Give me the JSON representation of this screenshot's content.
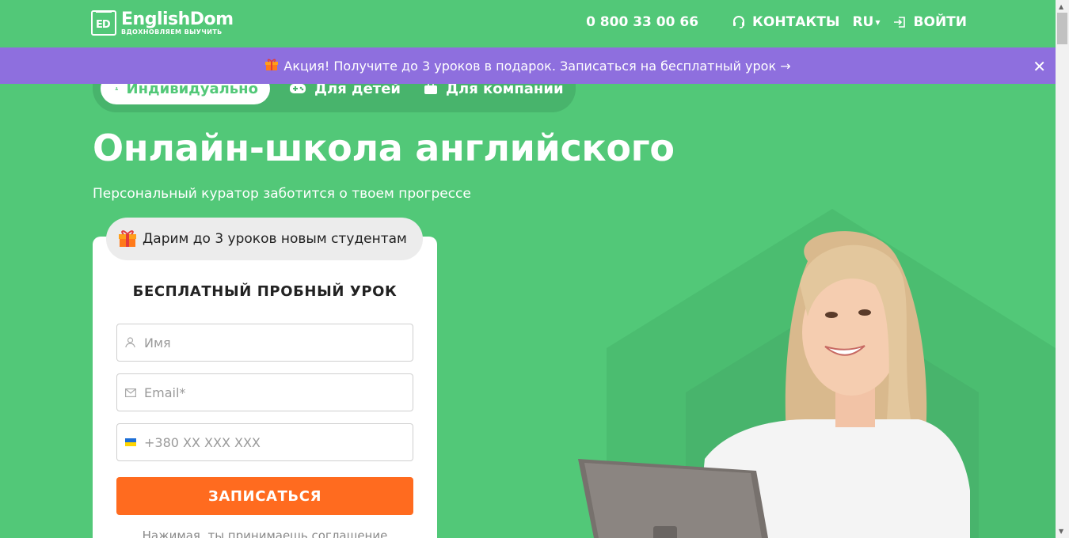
{
  "header": {
    "logo_mark": "ED",
    "logo_name": "EnglishDom",
    "logo_tagline": "ВДОХНОВЛЯЕМ ВЫУЧИТЬ",
    "phone": "0 800 33 00 66",
    "contacts_label": "КОНТАКТЫ",
    "lang": "RU",
    "login_label": "ВОЙТИ"
  },
  "promo": {
    "text": "Акция! Получите до 3 уроков в подарок. Записаться на бесплатный урок →",
    "close": "✕"
  },
  "tabs": [
    {
      "label": "Индивидуально",
      "active": true
    },
    {
      "label": "Для детей",
      "active": false
    },
    {
      "label": "Для компании",
      "active": false
    }
  ],
  "hero": {
    "title": "Онлайн-школа английского",
    "subtitle": "Персональный куратор заботится о твоем прогрессе"
  },
  "form": {
    "gift_text": "Дарим до 3 уроков новым студентам",
    "title": "БЕСПЛАТНЫЙ ПРОБНЫЙ УРОК",
    "name_placeholder": "Имя",
    "email_placeholder": "Email*",
    "phone_placeholder": "+380 XX XXX XXX",
    "submit_label": "ЗАПИСАТЬСЯ",
    "agreement": "Нажимая, ты принимаешь соглашение"
  },
  "colors": {
    "brand_green": "#52c878",
    "promo_purple": "#8e6fde",
    "cta_orange": "#ff6b1f"
  }
}
